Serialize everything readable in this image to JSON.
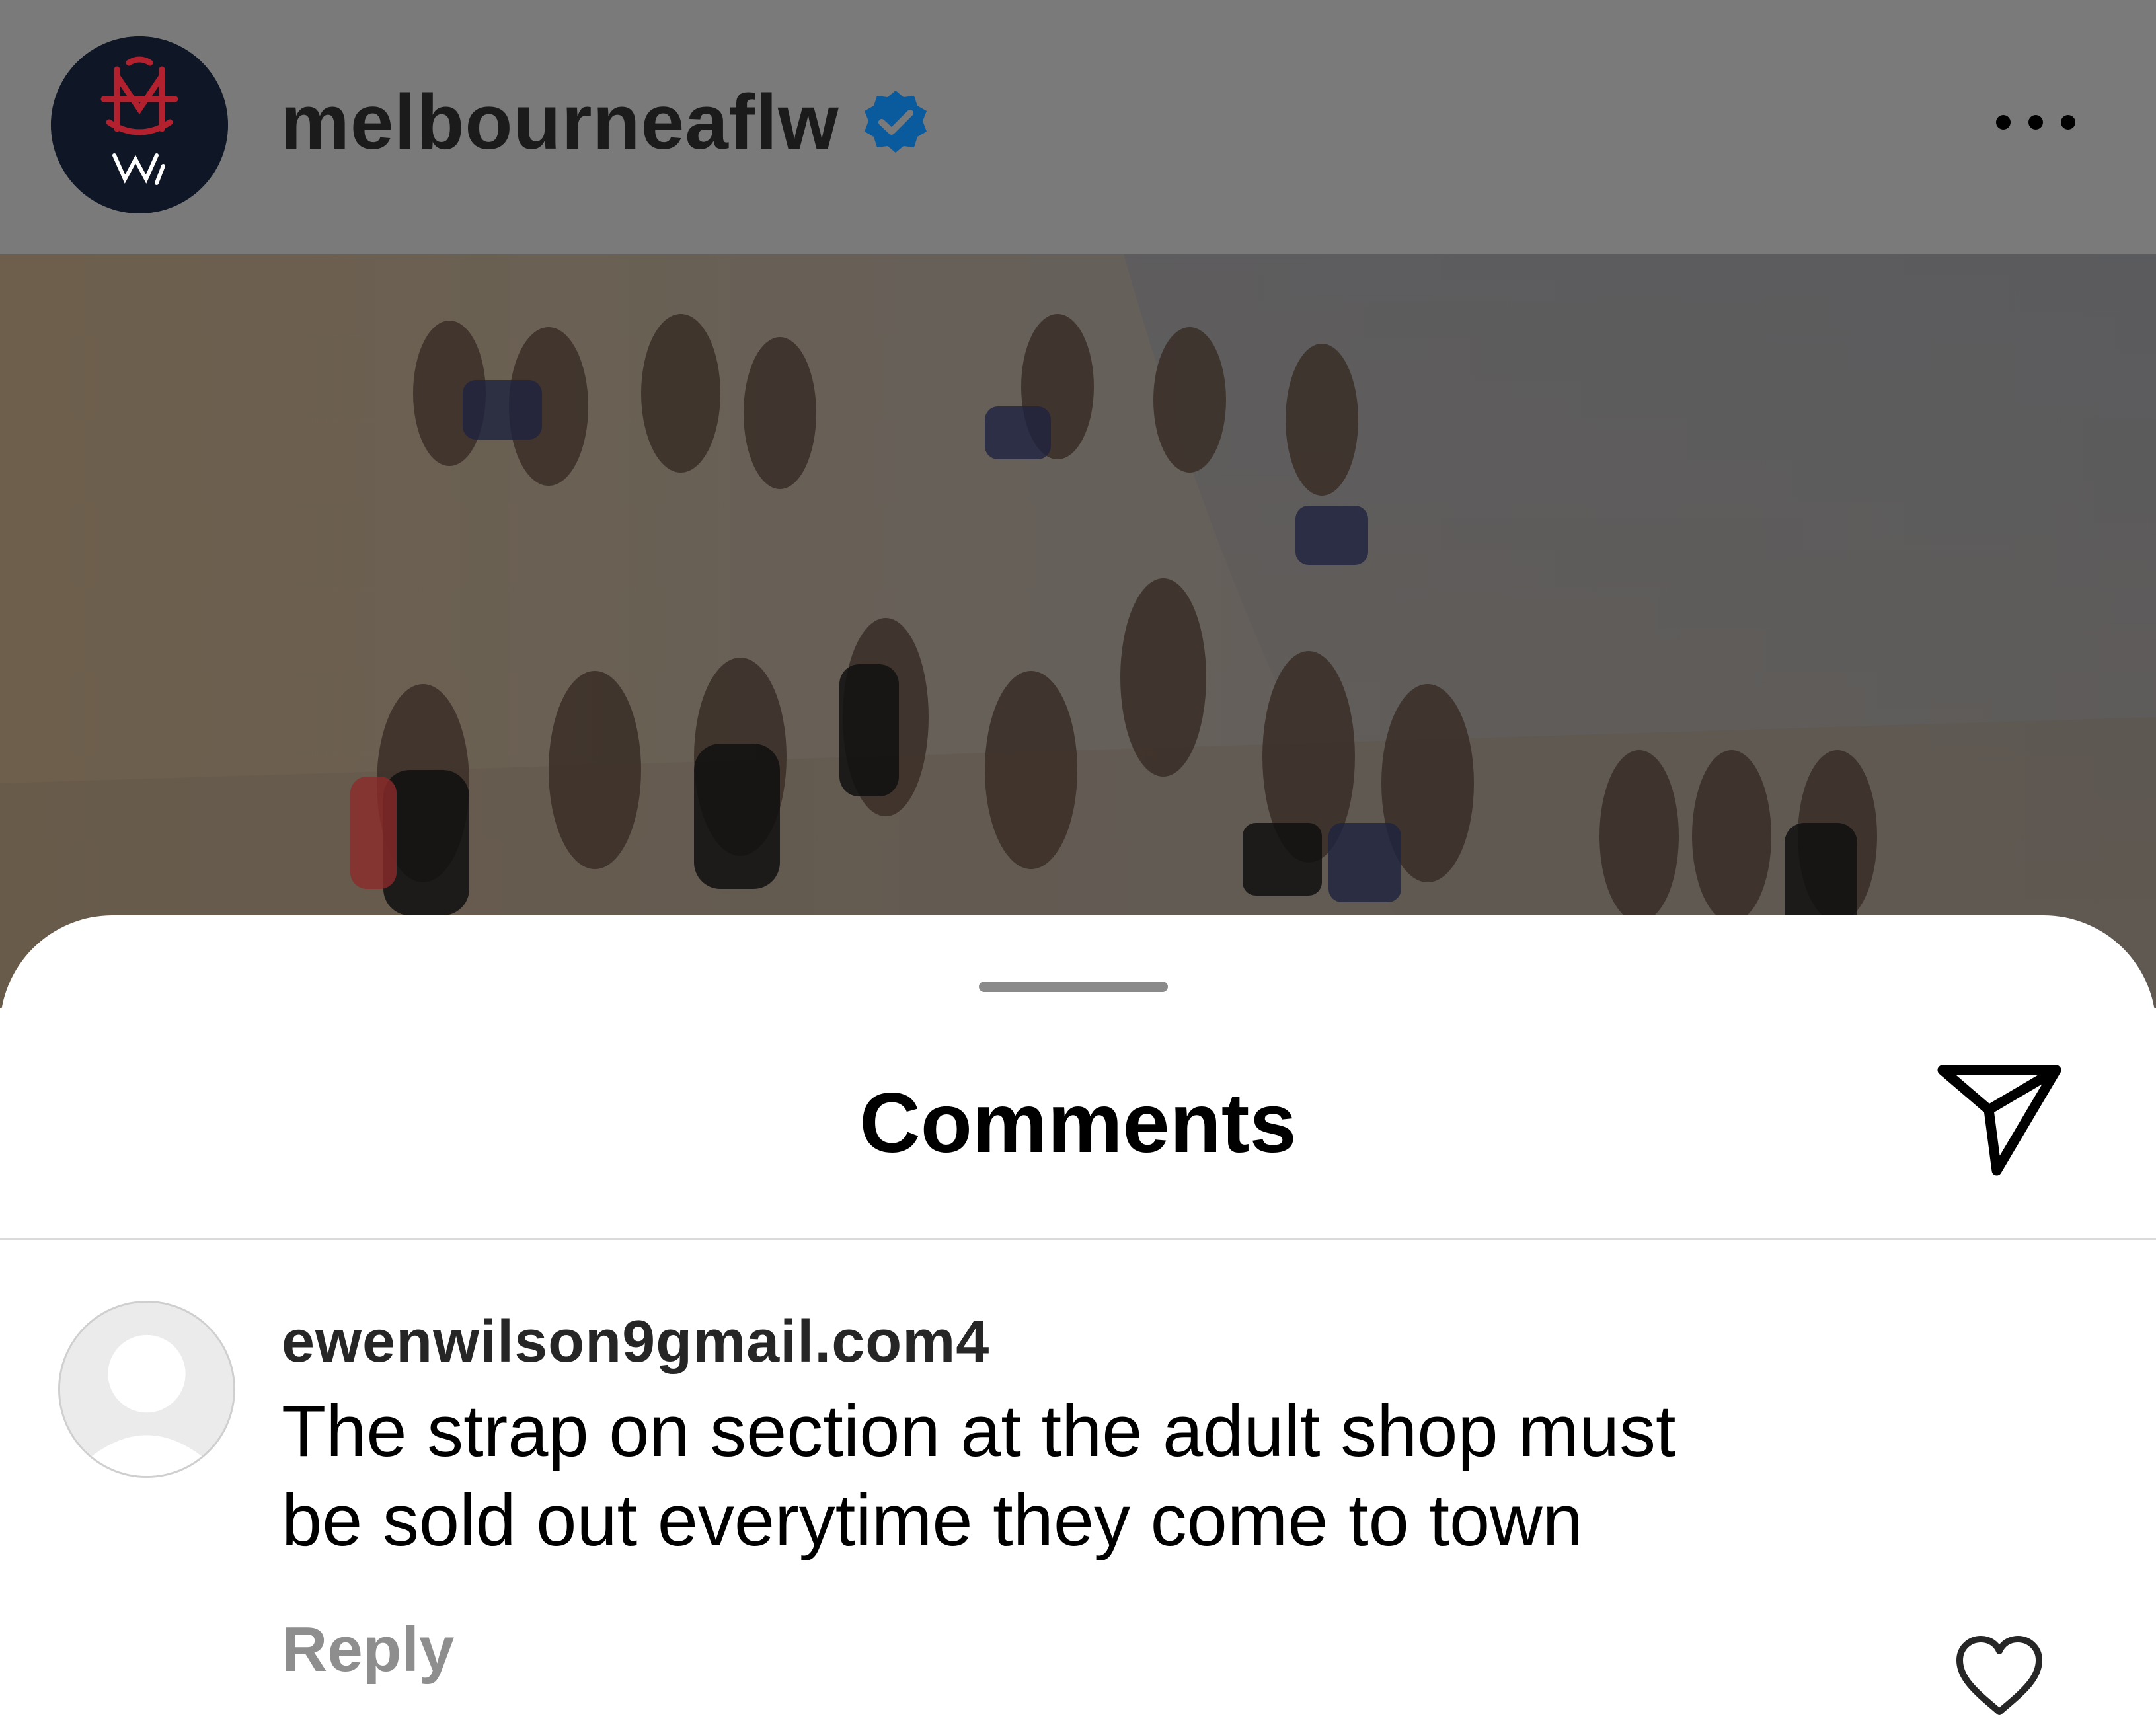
{
  "post": {
    "username": "melbourneaflw",
    "verified": true,
    "avatar_icon": "melbourne-fc-logo-icon",
    "more_icon": "more-options-icon",
    "photo_description_icon": "post-photo"
  },
  "comments_sheet": {
    "title": "Comments",
    "share_icon": "paper-plane-icon"
  },
  "comments": [
    {
      "username": "ewenwilson9gmail.com4",
      "text_lines": [
        "The strap on section at the adult shop must",
        "be sold out everytime they come to town"
      ],
      "reply_label": "Reply",
      "like_icon": "heart-outline-icon"
    }
  ],
  "colors": {
    "header_dim": "#7a7a7a",
    "badge_blue": "#0a5a9e",
    "reply_gray": "#8e8e8e",
    "divider": "#dbdbdb"
  }
}
